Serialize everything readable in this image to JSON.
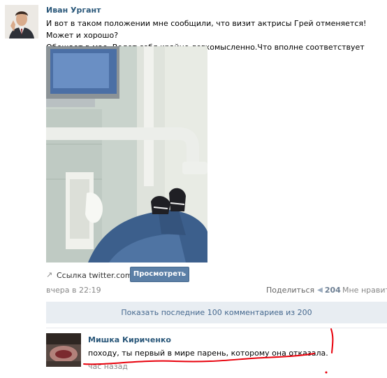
{
  "post": {
    "author": "Иван Ургант",
    "text_line1": "И вот в таком положении мне сообщили, что визит актрисы Грей отменяется! Может и хорошо?",
    "text_line2": "Обещает в мае. Ведет себя крайне легкомысленно.Что вполне соответствует жанру.",
    "link_label": "Ссылка twitter.com",
    "view_button": "Просмотреть",
    "time": "вчера в 22:19",
    "share_label": "Поделиться",
    "share_count": "204",
    "like_label": "Мне нравитс"
  },
  "comments_bar": {
    "label": "Показать последние 100 комментариев из 200"
  },
  "comment": {
    "author": "Мишка Кириченко",
    "text": "походу, ты первый в мире парень, которому она отказала.",
    "time": "час назад"
  },
  "icons": {
    "link": "link-arrow-icon",
    "share": "megaphone-icon"
  },
  "colors": {
    "link_blue": "#2b587a",
    "button_blue": "#5b7fa6",
    "bar_bg": "#e8edf2",
    "annotation_red": "#e8000b"
  }
}
